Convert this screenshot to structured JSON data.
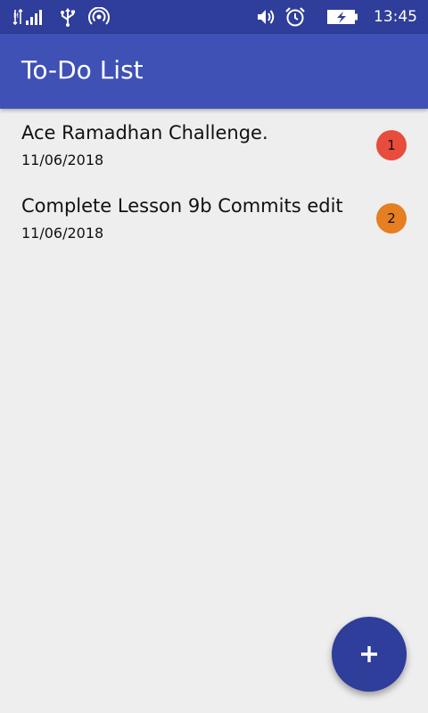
{
  "status_bar": {
    "time": "13:45",
    "icons": [
      "signal-icon",
      "usb-icon",
      "hotspot-icon",
      "volume-icon",
      "alarm-icon",
      "battery-charging-icon"
    ]
  },
  "app_bar": {
    "title": "To-Do List",
    "color": "#3f51b5",
    "status_color": "#2f3d9b"
  },
  "tasks": [
    {
      "title": "Ace Ramadhan Challenge.",
      "date": "11/06/2018",
      "priority": "1",
      "priority_color": "#e74c3c"
    },
    {
      "title": "Complete Lesson 9b Commits edit",
      "date": "11/06/2018",
      "priority": "2",
      "priority_color": "#e67e22"
    }
  ],
  "fab": {
    "icon": "add-icon",
    "color": "#2f3d9b"
  }
}
